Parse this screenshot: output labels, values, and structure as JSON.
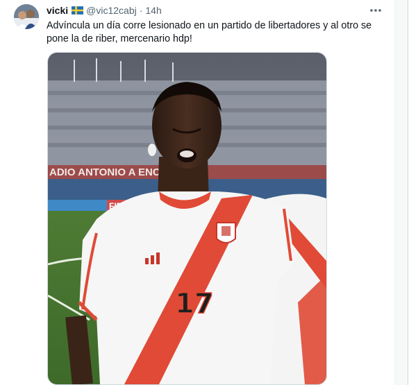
{
  "tweet": {
    "author_name": "vicki",
    "author_flag": "sweden-flag-icon",
    "author_handle": "@vic12cabj",
    "separator": "·",
    "time": "14h",
    "more_icon": "more-horizontal-icon",
    "text_lines": [
      "Advíncula un día corre lesionado en un partido de libertadores y al otro se",
      "pone la de riber, mercenario hdp!"
    ],
    "media": {
      "stadium_banner": "ADIO ANTONIO    A ENCINA",
      "board_text": "FIF",
      "jersey_number": "17"
    }
  },
  "colors": {
    "text_primary": "#0f1419",
    "text_secondary": "#536471",
    "border": "#cfd9de",
    "jersey_red": "#e04a36"
  }
}
